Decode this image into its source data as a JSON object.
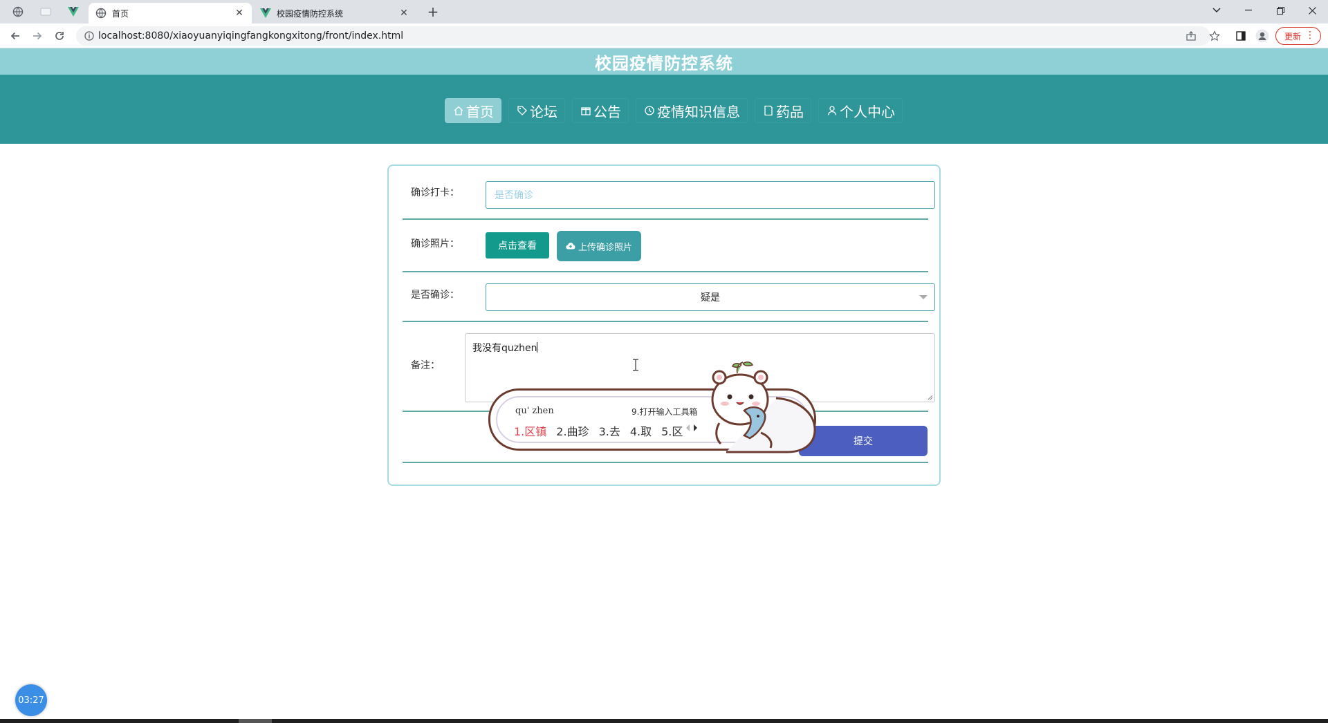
{
  "browser": {
    "tabs": [
      {
        "title": "首页",
        "icon": "globe-icon",
        "active": true
      },
      {
        "title": "校园疫情防控系统",
        "icon": "vue-icon",
        "active": false
      }
    ],
    "new_tab_label": "+",
    "url": "localhost:8080/xiaoyuanyiqingfangkongxitong/front/index.html",
    "update_label": "更新",
    "accent": "#d93025"
  },
  "site": {
    "title": "校园疫情防控系统",
    "header_color": "#8fd0d6",
    "nav_color": "#2e9599"
  },
  "nav": {
    "items": [
      {
        "label": "首页",
        "icon": "home-icon",
        "active": true
      },
      {
        "label": "论坛",
        "icon": "tag-icon",
        "active": false
      },
      {
        "label": "公告",
        "icon": "gift-icon",
        "active": false
      },
      {
        "label": "疫情知识信息",
        "icon": "clock-icon",
        "active": false
      },
      {
        "label": "药品",
        "icon": "bookmark-icon",
        "active": false
      },
      {
        "label": "个人中心",
        "icon": "user-icon",
        "active": false
      }
    ]
  },
  "form": {
    "checkin": {
      "label": "确诊打卡：",
      "placeholder": "是否确诊"
    },
    "photo": {
      "label": "确诊照片：",
      "view_button": "点击查看",
      "upload_button": "上传确诊照片"
    },
    "confirmed": {
      "label": "是否确诊：",
      "selected": "疑是"
    },
    "remark": {
      "label": "备注：",
      "value": "我没有quzhen"
    },
    "submit_label": "提交"
  },
  "ime": {
    "pinyin": "qu' zhen",
    "tools_hint": "9.打开输入工具箱",
    "candidates": [
      "1.区镇",
      "2.曲珍",
      "3.去",
      "4.取",
      "5.区"
    ]
  },
  "timer": "03:27"
}
